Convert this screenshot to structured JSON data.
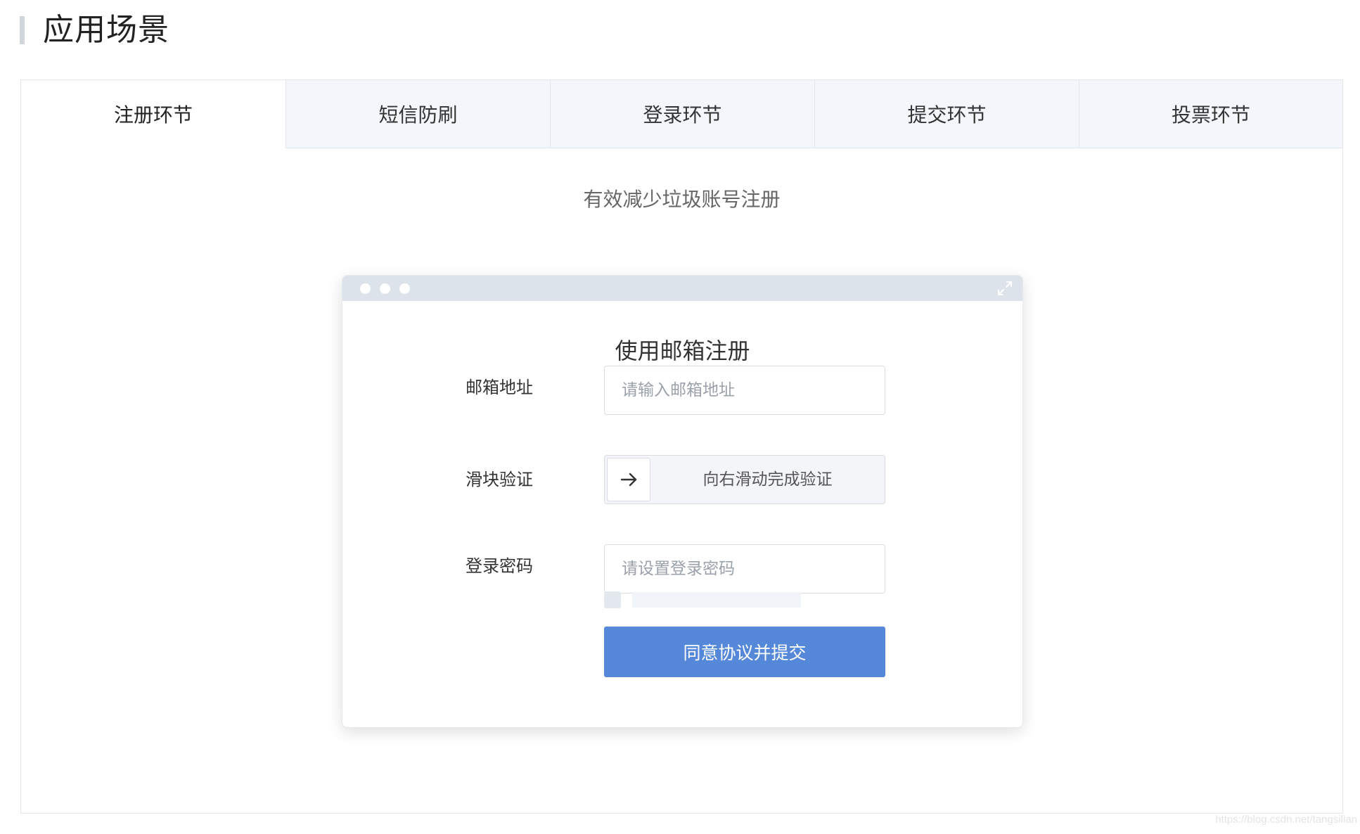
{
  "section": {
    "title": "应用场景"
  },
  "tabs": [
    {
      "label": "注册环节",
      "active": true
    },
    {
      "label": "短信防刷",
      "active": false
    },
    {
      "label": "登录环节",
      "active": false
    },
    {
      "label": "提交环节",
      "active": false
    },
    {
      "label": "投票环节",
      "active": false
    }
  ],
  "tab_caption": "有效减少垃圾账号注册",
  "demo_form": {
    "title": "使用邮箱注册",
    "email": {
      "label": "邮箱地址",
      "placeholder": "请输入邮箱地址",
      "value": ""
    },
    "slider": {
      "label": "滑块验证",
      "text": "向右滑动完成验证",
      "handle_icon": "arrow-right-icon"
    },
    "password": {
      "label": "登录密码",
      "placeholder": "请设置登录密码",
      "value": ""
    },
    "agreement": {
      "checked": false
    },
    "submit_label": "同意协议并提交"
  },
  "window_controls": {
    "dots": [
      "window-dot",
      "window-dot",
      "window-dot"
    ],
    "expand_icon": "expand-icon"
  },
  "colors": {
    "primary": "#5588d9",
    "tab_inactive_bg": "#f3f6fa",
    "window_bar": "#dde3ea",
    "border": "#e3e6eb"
  },
  "watermark": "https://blog.csdn.net/tangsilian"
}
